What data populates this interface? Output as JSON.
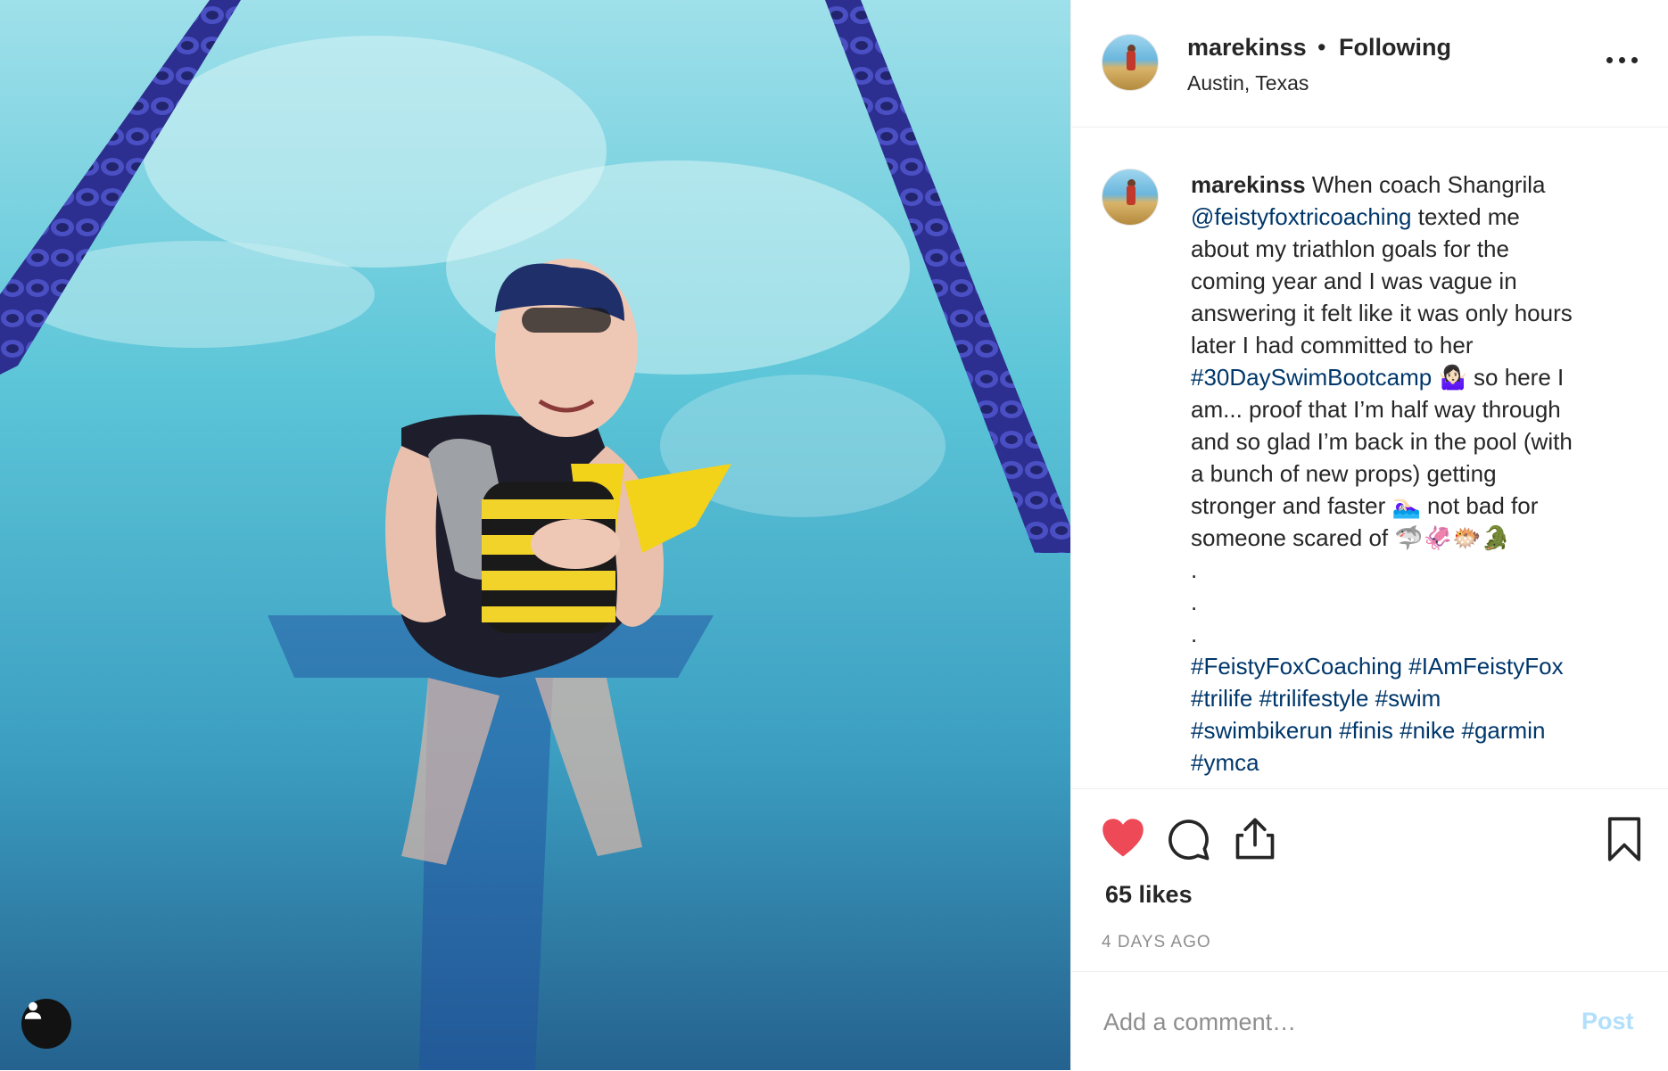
{
  "photo": {
    "alt_icon": "user-silhouette-icon"
  },
  "header": {
    "username": "marekinss",
    "separator": "•",
    "follow_state": "Following",
    "location": "Austin, Texas",
    "more_icon": "more-horizontal-icon"
  },
  "caption": {
    "username": "marekinss",
    "t1": " When coach Shangrila\n",
    "mention": "@feistyfoxtricoaching",
    "t2": " texted me\nabout my triathlon goals for the\ncoming year and I was vague in\nanswering it felt like it was only hours\nlater I had committed to her\n",
    "hashtag1": "#30DaySwimBootcamp",
    "t3": " 🤷🏻‍♀️ so here I\nam... proof that I’m half way through\nand so glad I’m back in the pool (with\na bunch of new props) getting\nstronger and faster 🏊🏻‍♀️ not bad for\nsomeone scared of 🦈🦑🐡🐊\n.\n.\n.\n",
    "tags": [
      {
        "text": "#FeistyFoxCoaching",
        "sep": " "
      },
      {
        "text": "#IAmFeistyFox",
        "sep": "\n"
      },
      {
        "text": "#trilife",
        "sep": " "
      },
      {
        "text": "#trilifestyle",
        "sep": " "
      },
      {
        "text": "#swim",
        "sep": "\n"
      },
      {
        "text": "#swimbikerun",
        "sep": " "
      },
      {
        "text": "#finis",
        "sep": " "
      },
      {
        "text": "#nike",
        "sep": " "
      },
      {
        "text": "#garmin",
        "sep": "\n"
      },
      {
        "text": "#ymca",
        "sep": ""
      }
    ]
  },
  "actions": {
    "like_icon": "heart-filled-icon",
    "comment_icon": "comment-icon",
    "share_icon": "share-icon",
    "save_icon": "bookmark-icon",
    "like_color": "#ed4956"
  },
  "likes": "65 likes",
  "time_ago": "4 DAYS AGO",
  "comment": {
    "placeholder": "Add a comment…",
    "value": "",
    "post_label": "Post"
  }
}
